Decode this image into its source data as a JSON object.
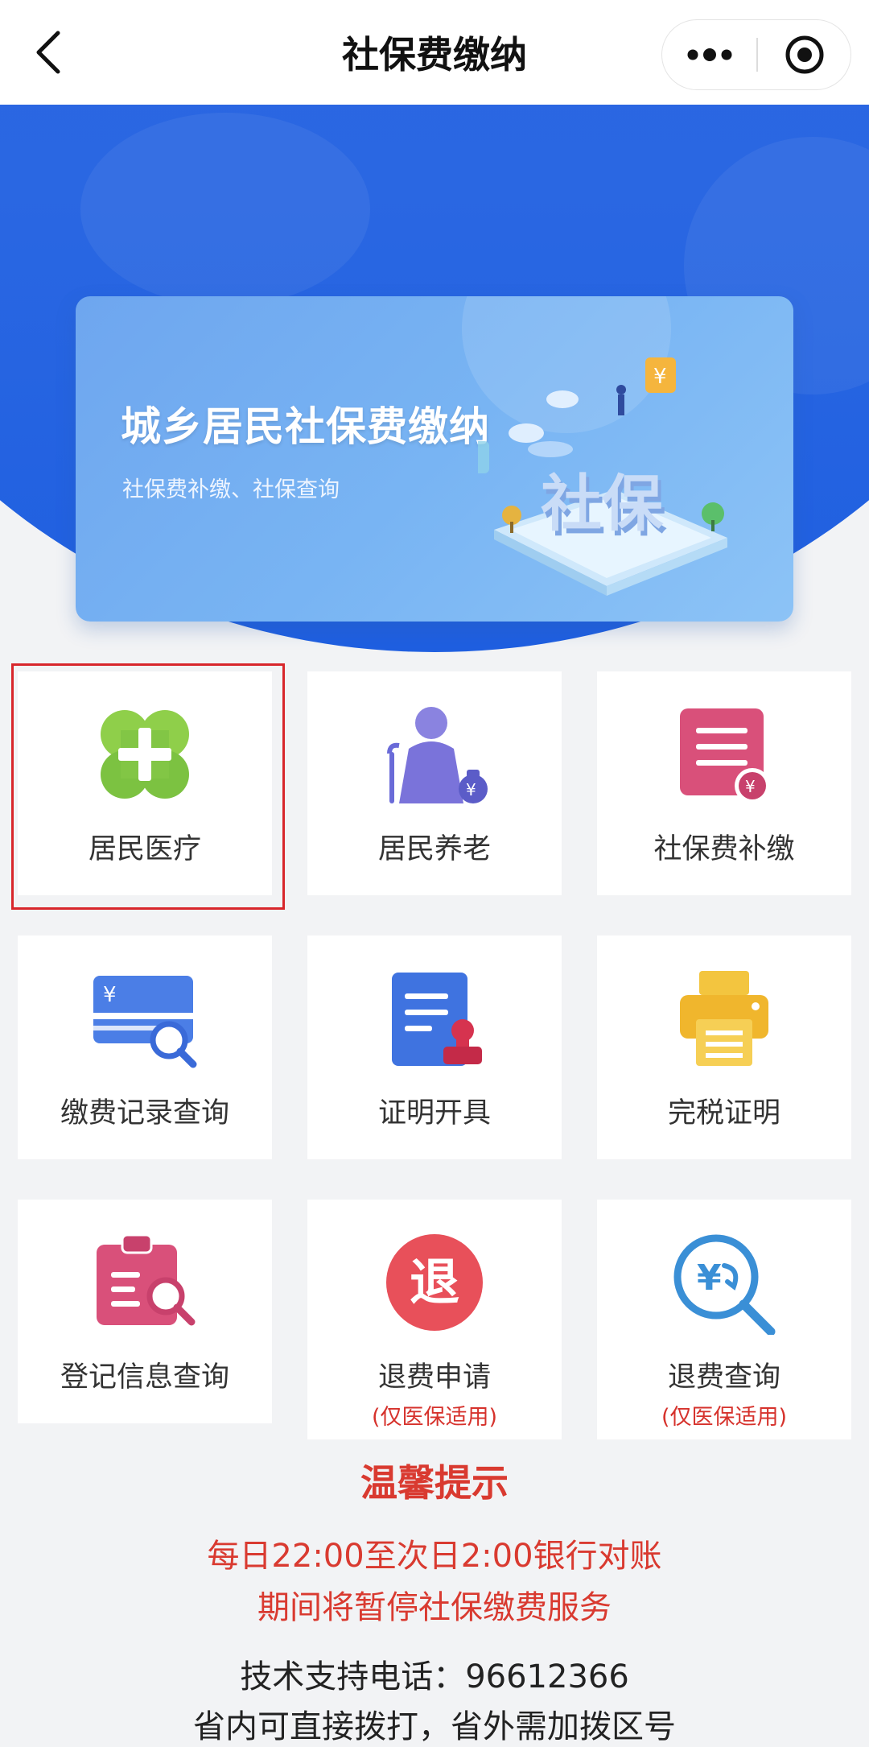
{
  "nav": {
    "title": "社保费缴纳",
    "back_icon": "chevron-left-icon",
    "more_icon": "more-dots-icon",
    "close_icon": "target-close-icon"
  },
  "banner": {
    "title": "城乡居民社保费缴纳",
    "subtitle": "社保费补缴、社保查询",
    "illustration_text": "社保",
    "coin_symbol": "¥"
  },
  "services": [
    {
      "label": "居民医疗",
      "icon": "medical-cross-icon",
      "color": "#7cc241",
      "note": ""
    },
    {
      "label": "居民养老",
      "icon": "elderly-person-icon",
      "color": "#6a6bd8",
      "note": ""
    },
    {
      "label": "社保费补缴",
      "icon": "document-yen-icon",
      "color": "#d9507a",
      "note": ""
    },
    {
      "label": "缴费记录查询",
      "icon": "card-search-icon",
      "color": "#3f73e0",
      "note": ""
    },
    {
      "label": "证明开具",
      "icon": "certificate-stamp-icon",
      "color": "#3f73e0",
      "note": ""
    },
    {
      "label": "完税证明",
      "icon": "printer-icon",
      "color": "#f0b62d",
      "note": ""
    },
    {
      "label": "登记信息查询",
      "icon": "clipboard-search-icon",
      "color": "#d9507a",
      "note": ""
    },
    {
      "label": "退费申请",
      "icon": "refund-badge-icon",
      "color": "#e8505a",
      "note": "(仅医保适用)",
      "badge_text": "退"
    },
    {
      "label": "退费查询",
      "icon": "refund-search-icon",
      "color": "#3a8fd6",
      "note": "(仅医保适用)"
    }
  ],
  "icon_text": {
    "yen": "¥"
  },
  "notice": {
    "title": "温馨提示",
    "line1": "每日22:00至次日2:00银行对账",
    "line2": "期间将暂停社保缴费服务"
  },
  "support": {
    "line1": "技术支持电话：96612366",
    "line2": "省内可直接拨打，省外需加拨区号"
  }
}
